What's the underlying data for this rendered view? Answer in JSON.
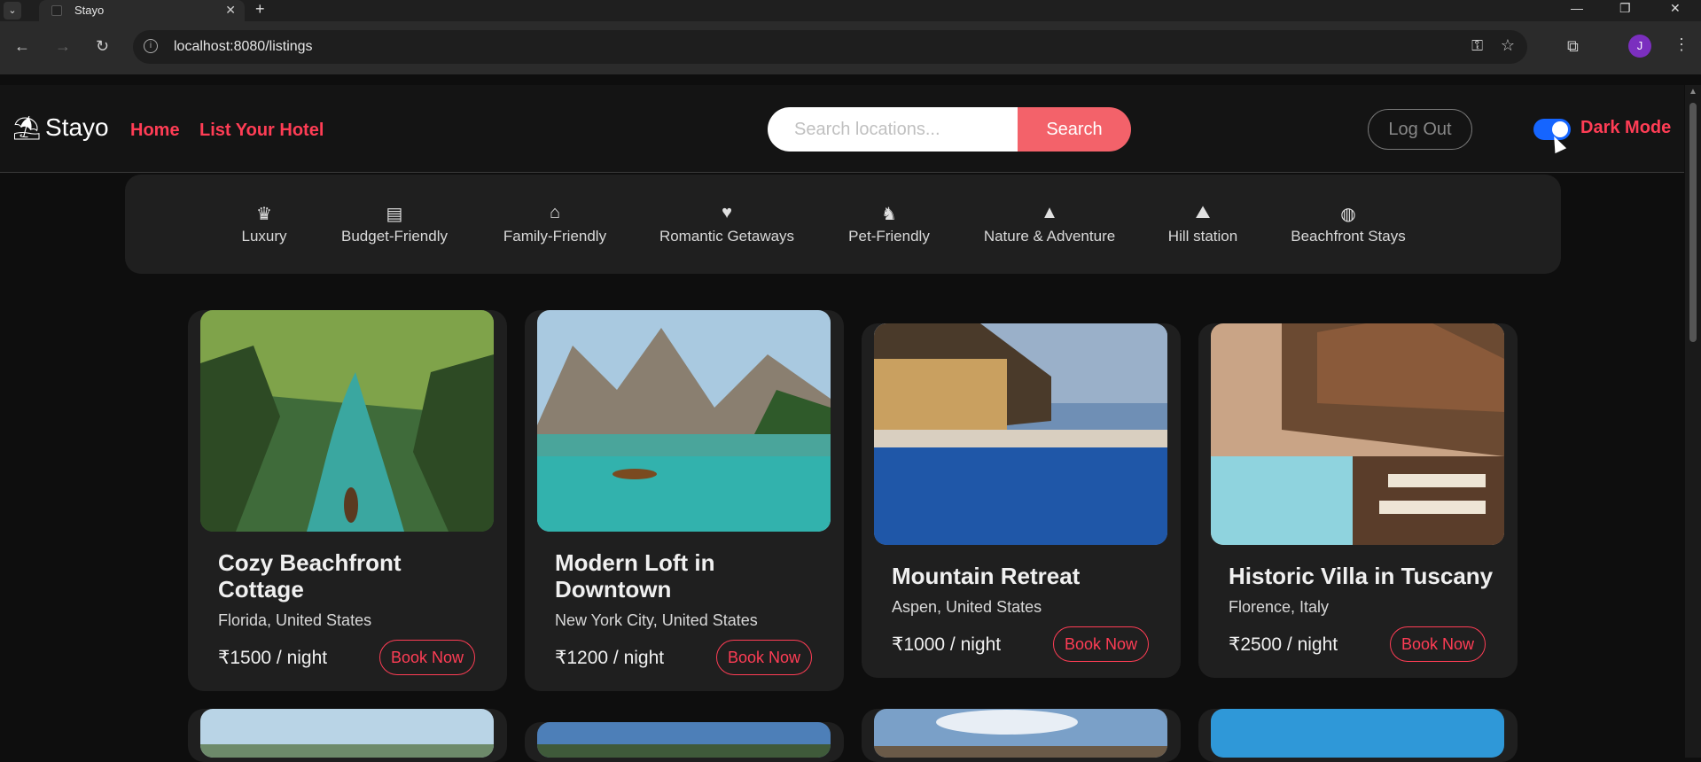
{
  "browser": {
    "tab_title": "Stayo",
    "url": "localhost:8080/listings",
    "avatar_letter": "J"
  },
  "header": {
    "logo_text": "Stayo",
    "nav": [
      "Home",
      "List Your Hotel"
    ],
    "search_placeholder": "Search locations...",
    "search_button": "Search",
    "logout": "Log Out",
    "dark_mode_label": "Dark Mode",
    "dark_mode_on": true
  },
  "categories": [
    {
      "label": "Luxury",
      "icon": "crown-icon"
    },
    {
      "label": "Budget-Friendly",
      "icon": "wallet-icon"
    },
    {
      "label": "Family-Friendly",
      "icon": "people-roof-icon"
    },
    {
      "label": "Romantic Getaways",
      "icon": "heart-icon"
    },
    {
      "label": "Pet-Friendly",
      "icon": "dog-icon"
    },
    {
      "label": "Nature & Adventure",
      "icon": "tree-icon"
    },
    {
      "label": "Hill station",
      "icon": "mountain-icon"
    },
    {
      "label": "Beachfront Stays",
      "icon": "volleyball-icon"
    }
  ],
  "listings": [
    {
      "title": "Cozy Beachfront Cottage",
      "location": "Florida, United States",
      "price": "₹1500 / night",
      "book": "Book Now"
    },
    {
      "title": "Modern Loft in Downtown",
      "location": "New York City, United States",
      "price": "₹1200 / night",
      "book": "Book Now"
    },
    {
      "title": "Mountain Retreat",
      "location": "Aspen, United States",
      "price": "₹1000 / night",
      "book": "Book Now"
    },
    {
      "title": "Historic Villa in Tuscany",
      "location": "Florence, Italy",
      "price": "₹2500 / night",
      "book": "Book Now"
    }
  ],
  "colors": {
    "accent": "#ff3d55",
    "search_button": "#f3626a",
    "toggle": "#1565ff",
    "background": "#0e0e0e",
    "card": "#1f1f1f"
  }
}
